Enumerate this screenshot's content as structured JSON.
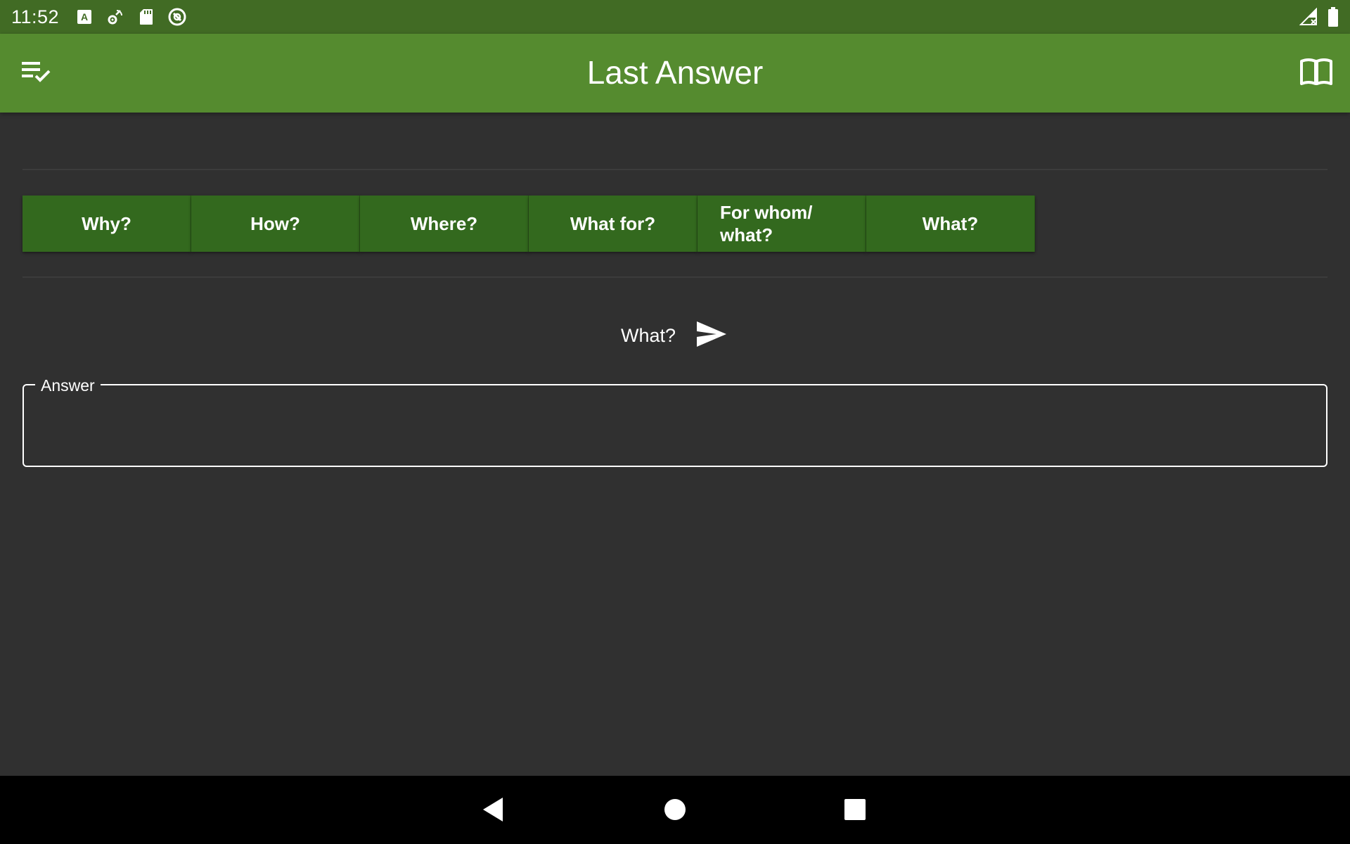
{
  "status_bar": {
    "time": "11:52",
    "icons_left": [
      "font-a-icon",
      "settings-antenna-icon",
      "sd-card-icon",
      "sync-off-icon"
    ],
    "icons_right": [
      "signal-icon",
      "battery-icon"
    ]
  },
  "app_bar": {
    "title": "Last Answer",
    "left_icon": "playlist-check-icon",
    "right_icon": "book-open-icon"
  },
  "questions": [
    {
      "label": "Why?"
    },
    {
      "label": "How?"
    },
    {
      "label": "Where?"
    },
    {
      "label": "What for?"
    },
    {
      "label": "For whom/\nwhat?"
    },
    {
      "label": "What?"
    }
  ],
  "selected_question": {
    "label": "What?",
    "send_icon": "send-icon"
  },
  "answer": {
    "label": "Answer",
    "value": ""
  },
  "colors": {
    "status_bar": "#416b24",
    "app_bar": "#558b2f",
    "button": "#33691e",
    "background": "#303030"
  },
  "nav_bar": {
    "icons": [
      "back-icon",
      "home-icon",
      "recents-icon"
    ]
  }
}
